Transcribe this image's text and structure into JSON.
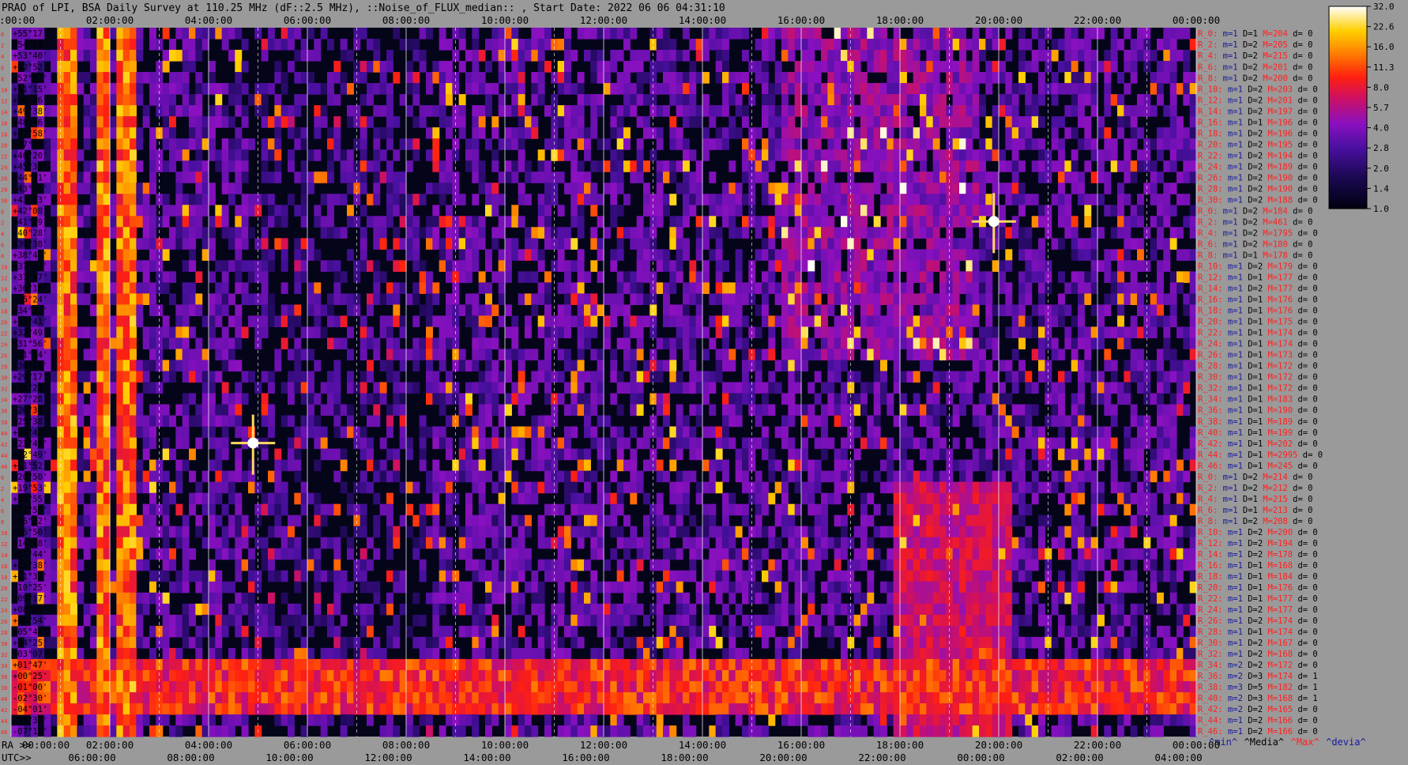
{
  "chart_data": {
    "type": "heatmap",
    "title": "PRAO of LPI, BSA Daily Survey at 110.25 MHz (dF::2.5 MHz), ::Noise_of_FLUX_median:: , Start Date: 2022 06 06 04:31:10",
    "top_time_ticks": [
      "00:00:00",
      "02:00:00",
      "04:00:00",
      "06:00:00",
      "08:00:00",
      "10:00:00",
      "12:00:00",
      "14:00:00",
      "16:00:00",
      "18:00:00",
      "20:00:00",
      "22:00:00",
      "00:00:00"
    ],
    "ra_ticks": [
      "00:00:00",
      "02:00:00",
      "04:00:00",
      "06:00:00",
      "08:00:00",
      "10:00:00",
      "12:00:00",
      "14:00:00",
      "16:00:00",
      "18:00:00",
      "20:00:00",
      "22:00:00",
      "00:00:00"
    ],
    "utc_ticks": [
      "06:00:00",
      "08:00:00",
      "10:00:00",
      "12:00:00",
      "14:00:00",
      "16:00:00",
      "18:00:00",
      "20:00:00",
      "22:00:00",
      "00:00:00",
      "02:00:00",
      "04:00:00"
    ],
    "ra_label": "RA >>",
    "utc_label": "UTC>>",
    "row_indices": [
      "0",
      "2",
      "4",
      "6",
      "8",
      "10",
      "12",
      "14",
      "16",
      "18",
      "20",
      "22",
      "24",
      "26",
      "28",
      "30",
      "0",
      "2",
      "4",
      "6",
      "8",
      "10",
      "12",
      "14",
      "16",
      "18",
      "20",
      "22",
      "24",
      "26",
      "28",
      "30",
      "32",
      "34",
      "36",
      "38",
      "40",
      "42",
      "44",
      "46",
      "0",
      "2",
      "4",
      "6",
      "8",
      "10",
      "12",
      "14",
      "16",
      "18",
      "20",
      "22",
      "24",
      "26",
      "28",
      "30",
      "32",
      "34",
      "36",
      "38",
      "40",
      "42",
      "44",
      "46"
    ],
    "declinations": [
      "+55°17'",
      "+54°29'",
      "+53°40'",
      "+52°52'",
      "+52°03'",
      "+51°15'",
      "+50°26'",
      "+49°38'",
      "+48°46'",
      "+47°58'",
      "+47°09'",
      "+46°20'",
      "+45°31'",
      "+44°41'",
      "+43°52'",
      "+43°03'",
      "+42°08'",
      "+41°19'",
      "+40°28'",
      "+39°38'",
      "+38°47'",
      "+37°57'",
      "+37°07'",
      "+36°16'",
      "+35°24'",
      "+34°32'",
      "+33°41'",
      "+32°49'",
      "+31°56'",
      "+31°04'",
      "+30°10'",
      "+29°17'",
      "+28°22'",
      "+27°28'",
      "+26°34'",
      "+25°38'",
      "+24°42'",
      "+23°46'",
      "+22°49'",
      "+21°52'",
      "+20°50'",
      "+19°53'",
      "+18°55'",
      "+17°55'",
      "+16°52'",
      "+15°50'",
      "+14°48'",
      "+13°44'",
      "+12°38'",
      "+11°32'",
      "+10°25'",
      "+09°17'",
      "+08°05'",
      "+06°54'",
      "+05°41'",
      "+04°25'",
      "+03°07'",
      "+01°47'",
      "+00°25'",
      "-01°00'",
      "-02°30'",
      "-04°01'",
      "-05°37'",
      "-07°19'"
    ],
    "row_stats": [
      {
        "r": "R_0:",
        "m": "m=1",
        "D": "D=1",
        "M": "M=204",
        "d": "d= 0"
      },
      {
        "r": "R_2:",
        "m": "m=1",
        "D": "D=2",
        "M": "M=205",
        "d": "d= 0"
      },
      {
        "r": "R_4:",
        "m": "m=1",
        "D": "D=2",
        "M": "M=215",
        "d": "d= 0"
      },
      {
        "r": "R_6:",
        "m": "m=1",
        "D": "D=2",
        "M": "M=201",
        "d": "d= 0"
      },
      {
        "r": "R_8:",
        "m": "m=1",
        "D": "D=2",
        "M": "M=200",
        "d": "d= 0"
      },
      {
        "r": "R_10:",
        "m": "m=1",
        "D": "D=2",
        "M": "M=203",
        "d": "d= 0"
      },
      {
        "r": "R_12:",
        "m": "m=1",
        "D": "D=2",
        "M": "M=201",
        "d": "d= 0"
      },
      {
        "r": "R_14:",
        "m": "m=1",
        "D": "D=2",
        "M": "M=197",
        "d": "d= 0"
      },
      {
        "r": "R_16:",
        "m": "m=1",
        "D": "D=1",
        "M": "M=196",
        "d": "d= 0"
      },
      {
        "r": "R_18:",
        "m": "m=1",
        "D": "D=2",
        "M": "M=196",
        "d": "d= 0"
      },
      {
        "r": "R_20:",
        "m": "m=1",
        "D": "D=2",
        "M": "M=195",
        "d": "d= 0"
      },
      {
        "r": "R_22:",
        "m": "m=1",
        "D": "D=2",
        "M": "M=194",
        "d": "d= 0"
      },
      {
        "r": "R_24:",
        "m": "m=1",
        "D": "D=2",
        "M": "M=189",
        "d": "d= 0"
      },
      {
        "r": "R_26:",
        "m": "m=1",
        "D": "D=2",
        "M": "M=190",
        "d": "d= 0"
      },
      {
        "r": "R_28:",
        "m": "m=1",
        "D": "D=2",
        "M": "M=190",
        "d": "d= 0"
      },
      {
        "r": "R_30:",
        "m": "m=1",
        "D": "D=2",
        "M": "M=188",
        "d": "d= 0"
      },
      {
        "r": "R_0:",
        "m": "m=1",
        "D": "D=2",
        "M": "M=184",
        "d": "d= 0"
      },
      {
        "r": "R_2:",
        "m": "m=1",
        "D": "D=2",
        "M": "M=461",
        "d": "d= 0"
      },
      {
        "r": "R_4:",
        "m": "m=1",
        "D": "D=2",
        "M": "M=1795",
        "d": "d= 0"
      },
      {
        "r": "R_6:",
        "m": "m=1",
        "D": "D=2",
        "M": "M=180",
        "d": "d= 0"
      },
      {
        "r": "R_8:",
        "m": "m=1",
        "D": "D=1",
        "M": "M=178",
        "d": "d= 0"
      },
      {
        "r": "R_10:",
        "m": "m=1",
        "D": "D=2",
        "M": "M=179",
        "d": "d= 0"
      },
      {
        "r": "R_12:",
        "m": "m=1",
        "D": "D=1",
        "M": "M=177",
        "d": "d= 0"
      },
      {
        "r": "R_14:",
        "m": "m=1",
        "D": "D=2",
        "M": "M=177",
        "d": "d= 0"
      },
      {
        "r": "R_16:",
        "m": "m=1",
        "D": "D=1",
        "M": "M=176",
        "d": "d= 0"
      },
      {
        "r": "R_18:",
        "m": "m=1",
        "D": "D=1",
        "M": "M=176",
        "d": "d= 0"
      },
      {
        "r": "R_20:",
        "m": "m=1",
        "D": "D=1",
        "M": "M=175",
        "d": "d= 0"
      },
      {
        "r": "R_22:",
        "m": "m=1",
        "D": "D=1",
        "M": "M=174",
        "d": "d= 0"
      },
      {
        "r": "R_24:",
        "m": "m=1",
        "D": "D=1",
        "M": "M=174",
        "d": "d= 0"
      },
      {
        "r": "R_26:",
        "m": "m=1",
        "D": "D=1",
        "M": "M=173",
        "d": "d= 0"
      },
      {
        "r": "R_28:",
        "m": "m=1",
        "D": "D=1",
        "M": "M=172",
        "d": "d= 0"
      },
      {
        "r": "R_30:",
        "m": "m=1",
        "D": "D=1",
        "M": "M=172",
        "d": "d= 0"
      },
      {
        "r": "R_32:",
        "m": "m=1",
        "D": "D=1",
        "M": "M=172",
        "d": "d= 0"
      },
      {
        "r": "R_34:",
        "m": "m=1",
        "D": "D=1",
        "M": "M=183",
        "d": "d= 0"
      },
      {
        "r": "R_36:",
        "m": "m=1",
        "D": "D=1",
        "M": "M=190",
        "d": "d= 0"
      },
      {
        "r": "R_38:",
        "m": "m=1",
        "D": "D=1",
        "M": "M=189",
        "d": "d= 0"
      },
      {
        "r": "R_40:",
        "m": "m=1",
        "D": "D=1",
        "M": "M=199",
        "d": "d= 0"
      },
      {
        "r": "R_42:",
        "m": "m=1",
        "D": "D=1",
        "M": "M=202",
        "d": "d= 0"
      },
      {
        "r": "R_44:",
        "m": "m=1",
        "D": "D=1",
        "M": "M=2995",
        "d": "d= 0"
      },
      {
        "r": "R_46:",
        "m": "m=1",
        "D": "D=1",
        "M": "M=245",
        "d": "d= 0"
      },
      {
        "r": "R_0:",
        "m": "m=1",
        "D": "D=2",
        "M": "M=214",
        "d": "d= 0"
      },
      {
        "r": "R_2:",
        "m": "m=1",
        "D": "D=2",
        "M": "M=212",
        "d": "d= 0"
      },
      {
        "r": "R_4:",
        "m": "m=1",
        "D": "D=1",
        "M": "M=215",
        "d": "d= 0"
      },
      {
        "r": "R_6:",
        "m": "m=1",
        "D": "D=1",
        "M": "M=213",
        "d": "d= 0"
      },
      {
        "r": "R_8:",
        "m": "m=1",
        "D": "D=2",
        "M": "M=208",
        "d": "d= 0"
      },
      {
        "r": "R_10:",
        "m": "m=1",
        "D": "D=2",
        "M": "M=200",
        "d": "d= 0"
      },
      {
        "r": "R_12:",
        "m": "m=1",
        "D": "D=2",
        "M": "M=194",
        "d": "d= 0"
      },
      {
        "r": "R_14:",
        "m": "m=1",
        "D": "D=2",
        "M": "M=178",
        "d": "d= 0"
      },
      {
        "r": "R_16:",
        "m": "m=1",
        "D": "D=1",
        "M": "M=168",
        "d": "d= 0"
      },
      {
        "r": "R_18:",
        "m": "m=1",
        "D": "D=1",
        "M": "M=184",
        "d": "d= 0"
      },
      {
        "r": "R_20:",
        "m": "m=1",
        "D": "D=1",
        "M": "M=176",
        "d": "d= 0"
      },
      {
        "r": "R_22:",
        "m": "m=1",
        "D": "D=1",
        "M": "M=177",
        "d": "d= 0"
      },
      {
        "r": "R_24:",
        "m": "m=1",
        "D": "D=2",
        "M": "M=177",
        "d": "d= 0"
      },
      {
        "r": "R_26:",
        "m": "m=1",
        "D": "D=2",
        "M": "M=174",
        "d": "d= 0"
      },
      {
        "r": "R_28:",
        "m": "m=1",
        "D": "D=1",
        "M": "M=174",
        "d": "d= 0"
      },
      {
        "r": "R_30:",
        "m": "m=1",
        "D": "D=2",
        "M": "M=167",
        "d": "d= 0"
      },
      {
        "r": "R_32:",
        "m": "m=1",
        "D": "D=2",
        "M": "M=168",
        "d": "d= 0"
      },
      {
        "r": "R_34:",
        "m": "m=2",
        "D": "D=2",
        "M": "M=172",
        "d": "d= 0"
      },
      {
        "r": "R_36:",
        "m": "m=2",
        "D": "D=3",
        "M": "M=174",
        "d": "d= 1"
      },
      {
        "r": "R_38:",
        "m": "m=3",
        "D": "D=5",
        "M": "M=182",
        "d": "d= 1"
      },
      {
        "r": "R_40:",
        "m": "m=2",
        "D": "D=3",
        "M": "M=168",
        "d": "d= 1"
      },
      {
        "r": "R_42:",
        "m": "m=2",
        "D": "D=2",
        "M": "M=165",
        "d": "d= 0"
      },
      {
        "r": "R_44:",
        "m": "m=1",
        "D": "D=2",
        "M": "M=166",
        "d": "d= 0"
      },
      {
        "r": "R_46:",
        "m": "m=1",
        "D": "D=2",
        "M": "M=166",
        "d": "d= 0"
      }
    ],
    "stats_legend": [
      "^min^",
      "^Media^",
      "^Max^",
      "^devia^"
    ],
    "colorbar": {
      "ticks": [
        "32.0",
        "22.6",
        "16.0",
        "11.3",
        "8.0",
        "5.7",
        "4.0",
        "2.8",
        "2.0",
        "1.4",
        "1.0"
      ],
      "scale": "log",
      "range": [
        1.0,
        32.0
      ]
    },
    "bright_sources": [
      {
        "ra_hours": 4.9,
        "row": 37,
        "label": ""
      },
      {
        "ra_hours": 19.9,
        "row": 17,
        "label": ""
      }
    ],
    "colors": {
      "background": "#9a9a9a",
      "plot_bg": "#05051a",
      "label_red": "#ff2020",
      "label_blue": "#1818a0",
      "text_black": "#000000",
      "colormap": [
        "#000010",
        "#1a0850",
        "#4a10a0",
        "#8a10c0",
        "#d01060",
        "#ff2010",
        "#ff8000",
        "#ffd000",
        "#ffffff"
      ]
    }
  }
}
